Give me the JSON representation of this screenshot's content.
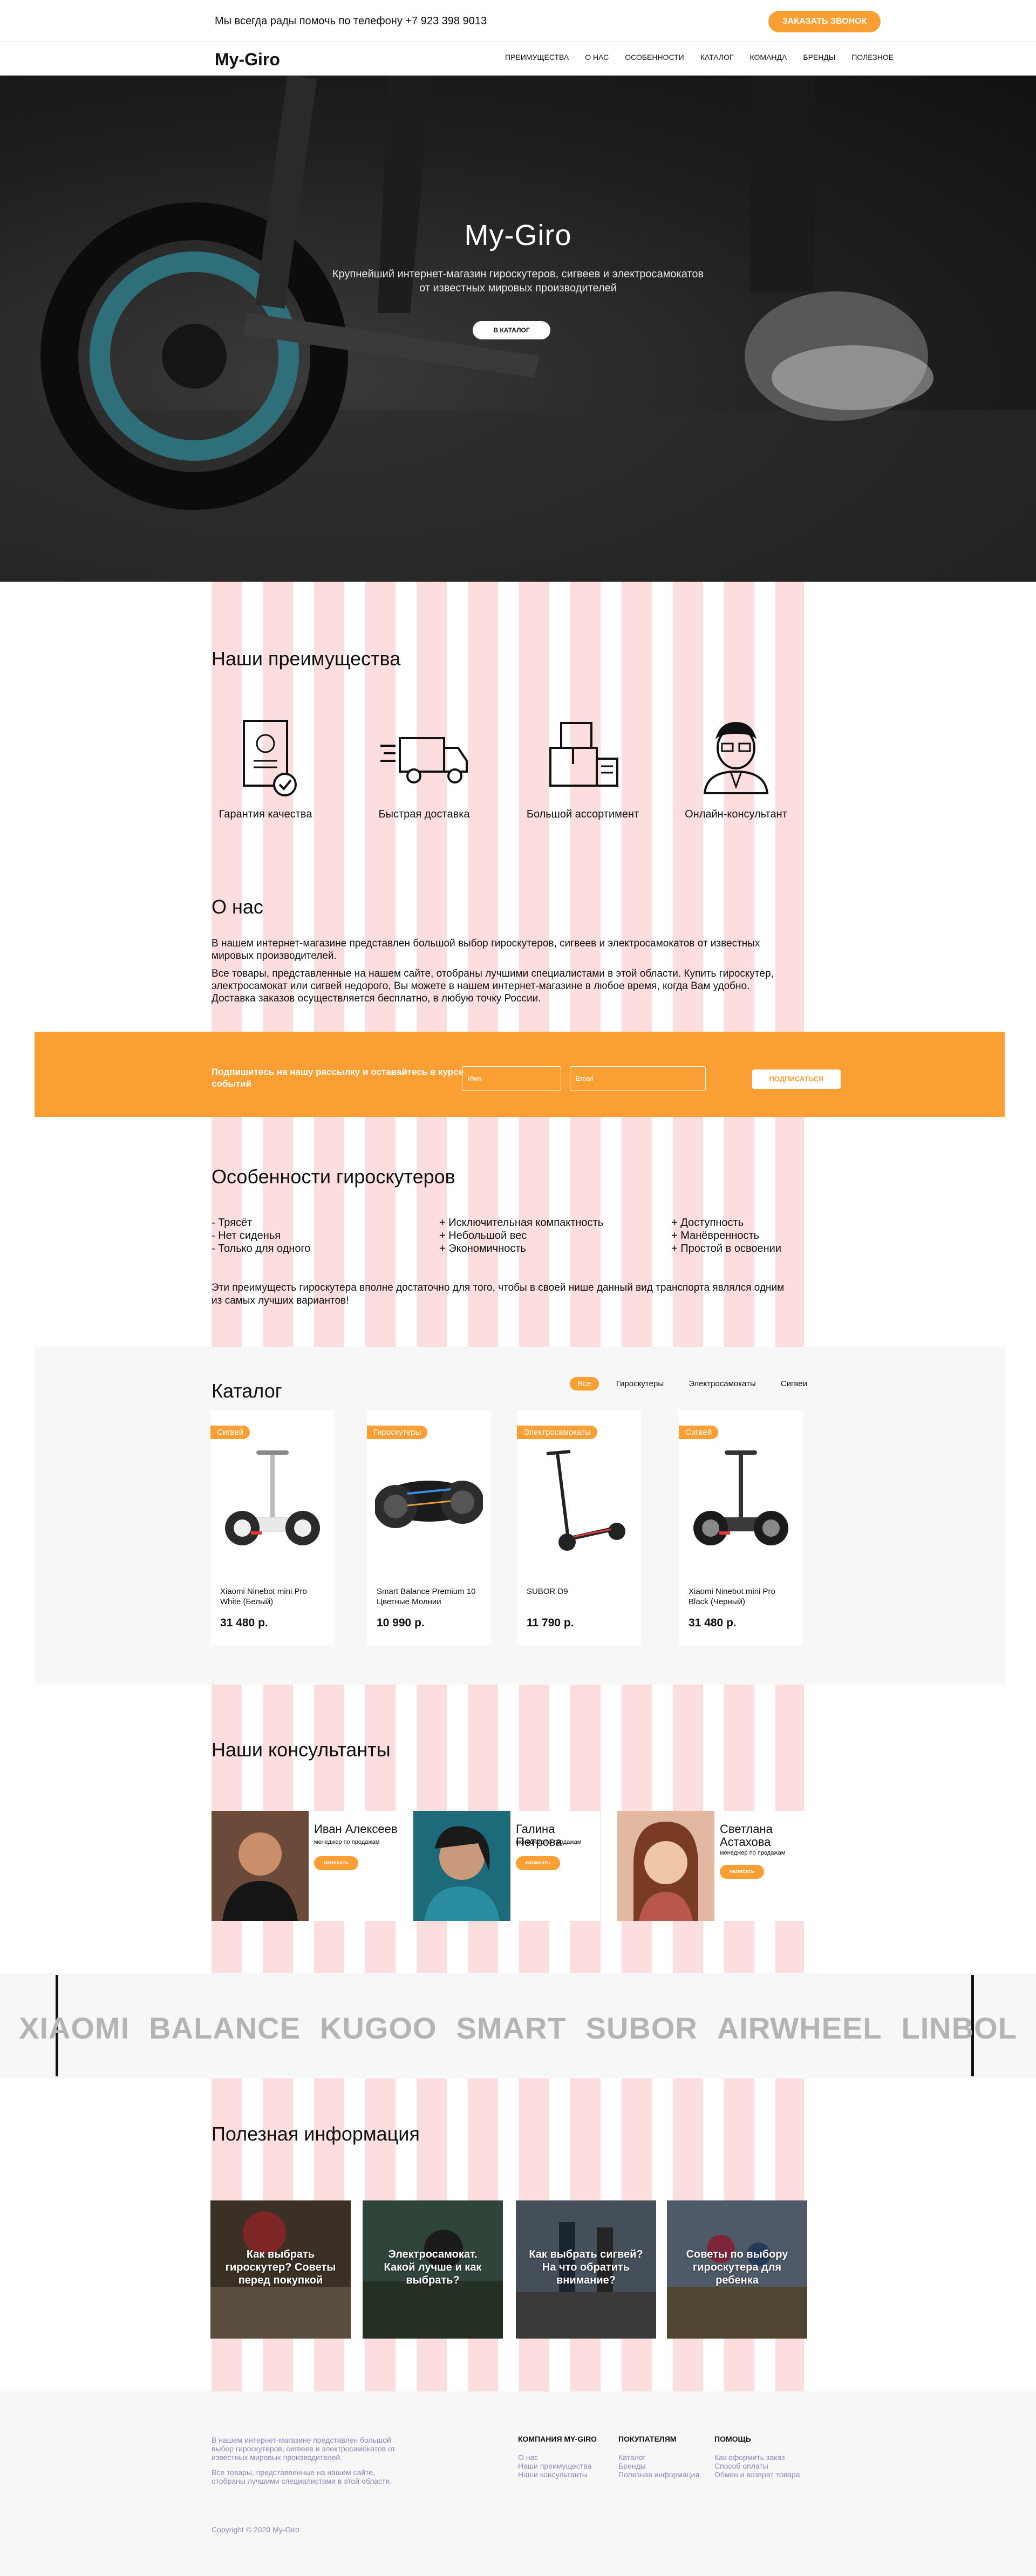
{
  "topbar": {
    "phone_text": "Мы всегда рады помочь по телефону +7 923 398 9013",
    "call_button": "ЗАКАЗАТЬ ЗВОНОК"
  },
  "nav": {
    "logo": "My-Giro",
    "items": [
      "ПРЕИМУЩЕСТВА",
      "О НАС",
      "ОСОБЕННОСТИ",
      "КАТАЛОГ",
      "КОМАНДА",
      "БРЕНДЫ",
      "ПОЛЕЗНОЕ"
    ]
  },
  "hero": {
    "title": "My-Giro",
    "subtitle_line1": "Крупнейший интернет-магазин гироскутеров, сигвеев и электросамокатов",
    "subtitle_line2": "от известных мировых производителей",
    "button": "В КАТАЛОГ"
  },
  "advantages": {
    "title": "Наши преимущества",
    "items": [
      {
        "label": "Гарантия качества",
        "icon": "certificate-icon"
      },
      {
        "label": "Быстрая доставка",
        "icon": "truck-icon"
      },
      {
        "label": "Большой  ассортимент",
        "icon": "boxes-icon"
      },
      {
        "label": "Онлайн-консультант",
        "icon": "consultant-icon"
      }
    ]
  },
  "about": {
    "title": "О нас",
    "p1": "В нашем интернет-магазине представлен большой выбор гироскутеров, сигвеев и электросамокатов от известных мировых производителей.",
    "p2": "Все товары, представленные на нашем сайте, отобраны лучшими специалистами в этой области. Купить гироскутер, электросамокат или сигвей недорого, Вы можете в нашем интернет-магазине в любое время, когда Вам удобно. Доставка заказов осуществляется бесплатно, в любую точку России."
  },
  "subscribe": {
    "text": "Подпишитесь на нашу рассылку и оставайтесь в курсе событий",
    "name_placeholder": "Имя",
    "email_placeholder": "Email",
    "button": "ПОДПИСАТЬСЯ"
  },
  "features": {
    "title": "Особенности гироскутеров",
    "minus": [
      "- Трясёт",
      "- Нет сиденья",
      "- Только для одного"
    ],
    "plus_a": [
      "+ Исключительная компактность",
      "+ Небольшой вес",
      "+ Экономичность"
    ],
    "plus_b": [
      "+ Доступность",
      "+ Манёвренность",
      "+ Простой в освоении"
    ],
    "summary": "Эти преимущесть гироскутера вполне достаточно для того, чтобы в своей нише данный вид транспорта являлся одним из самых лучших вариантов!"
  },
  "catalog": {
    "title": "Каталог",
    "filters": [
      "Все",
      "Гироскутеры",
      "Электросамокаты",
      "Сигвеи"
    ],
    "products": [
      {
        "badge": "Сигвей",
        "name": "Xiaomi Ninebot mini Pro White (Белый)",
        "price": "31 480 р."
      },
      {
        "badge": "Гироскутеры",
        "name": "Smart Balance Premium 10 Цветные Молнии",
        "price": "10 990 р."
      },
      {
        "badge": "Электросамокаты",
        "name": "SUBOR D9",
        "price": "11 790 р."
      },
      {
        "badge": "Сигвей",
        "name": "Xiaomi Ninebot mini Pro Black (Черный)",
        "price": "31 480 р."
      }
    ]
  },
  "consultants": {
    "title": "Наши консультанты",
    "people": [
      {
        "name": "Иван Алексеев",
        "role": "менеджер по продажам",
        "button": "написать"
      },
      {
        "name": "Галина Петрова",
        "role": "менеджер по продажам",
        "button": "написать"
      },
      {
        "name": "Светлана Астахова",
        "role": "менеджер по продажам",
        "button": "написать"
      }
    ]
  },
  "brands": [
    "XIAOMI",
    "BALANCE",
    "KUGOO",
    "SMART",
    "SUBOR",
    "AIRWHEEL",
    "LINBOL"
  ],
  "info": {
    "title": "Полезная информация",
    "articles": [
      "Как выбрать гироскутер? Советы перед покупкой",
      "Электросамокат. Какой лучше и как выбрать?",
      "Как выбрать сигвей? На что обратить внимание?",
      "Советы по выбору гироскутера для ребенка"
    ]
  },
  "footer": {
    "desc1": "В нашем интернет-магазине представлен большой выбор гироскутеров, сигвеев и электросамокатов от известных мировых производителей.",
    "desc2": "Все товары, представленные на нашем сайте, отобраны лучшими специалистами в этой области.",
    "col1": {
      "heading": "КОМПАНИЯ MY-GIRO",
      "links": [
        "О нас",
        "Наши преимущества",
        "Наши консультанты"
      ]
    },
    "col2": {
      "heading": "ПОКУПАТЕЛЯМ",
      "links": [
        "Каталог",
        "Бренды",
        "Полезная информация"
      ]
    },
    "col3": {
      "heading": "ПОМОЩЬ",
      "links": [
        "Как оформить заказ",
        "Способ оплаты",
        "Обмен и возврат товара"
      ]
    },
    "copyright": "Copyright © 2020 My-Giro"
  },
  "colors": {
    "accent": "#fa9f33",
    "stripe": "#fcdede",
    "muted_link": "#8a8ab8"
  }
}
